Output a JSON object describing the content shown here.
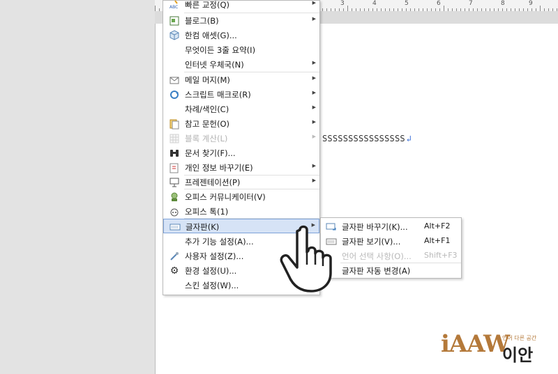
{
  "ruler": {
    "numbers": [
      "3",
      "4",
      "5",
      "6",
      "7",
      "8",
      "9"
    ]
  },
  "document": {
    "text": "SSSSSSSSSSSSSSSS",
    "return_mark": "↲"
  },
  "menu": {
    "items": [
      {
        "label": "빠른 교정(Q)",
        "icon": "abc-icon",
        "submenu": true
      },
      {
        "label": "블로그(B)",
        "icon": "blog-icon",
        "submenu": true
      },
      {
        "label": "한컴 애셋(G)...",
        "icon": "asset-cube-icon"
      },
      {
        "label": "무엇이든 3줄 요약(I)",
        "icon": ""
      },
      {
        "label": "인터넷 우체국(N)",
        "icon": "",
        "submenu": true
      },
      {
        "label": "메일 머지(M)",
        "icon": "mail-icon",
        "submenu": true
      },
      {
        "label": "스크립트 매크로(R)",
        "icon": "script-macro-icon",
        "submenu": true
      },
      {
        "label": "차례/색인(C)",
        "icon": "",
        "submenu": true
      },
      {
        "label": "참고 문헌(O)",
        "icon": "reference-icon",
        "submenu": true
      },
      {
        "label": "블록 계산(L)",
        "icon": "block-calc-icon",
        "submenu": true,
        "disabled": true
      },
      {
        "label": "문서 찾기(F)...",
        "icon": "binoculars-icon"
      },
      {
        "label": "개인 정보 바꾸기(E)",
        "icon": "personal-info-icon",
        "submenu": true
      },
      {
        "label": "프레젠테이션(P)",
        "icon": "presentation-icon",
        "submenu": true
      },
      {
        "label": "오피스 커뮤니케이터(V)",
        "icon": "communicator-icon"
      },
      {
        "label": "오피스 톡(1)",
        "icon": "office-talk-icon"
      },
      {
        "label": "글자판(K)",
        "icon": "keyboard-icon",
        "submenu": true,
        "active": true
      },
      {
        "label": "추가 기능 설정(A)...",
        "icon": ""
      },
      {
        "label": "사용자 설정(Z)...",
        "icon": "user-settings-icon"
      },
      {
        "label": "환경 설정(U)...",
        "icon": "gear-icon"
      },
      {
        "label": "스킨 설정(W)...",
        "icon": ""
      }
    ]
  },
  "submenu": {
    "items": [
      {
        "label": "글자판 바꾸기(K)...",
        "shortcut": "Alt+F2",
        "icon": "keyboard-switch-icon"
      },
      {
        "label": "글자판 보기(V)...",
        "shortcut": "Alt+F1",
        "icon": "keyboard-view-icon"
      },
      {
        "label": "언어 선택 사항(O)...",
        "shortcut": "Shift+F3",
        "icon": "",
        "disabled": true
      },
      {
        "label": "글자판 자동 변경(A)",
        "shortcut": "",
        "icon": ""
      }
    ]
  },
  "logo": {
    "brand": "iAAW",
    "tagline": "언어 다른 공간",
    "name": "이안"
  },
  "colors": {
    "highlight": "#d6e3f6",
    "highlight_border": "#7da2d8",
    "logo_gold": "#b4793a",
    "logo_dot": "#c3372c"
  }
}
